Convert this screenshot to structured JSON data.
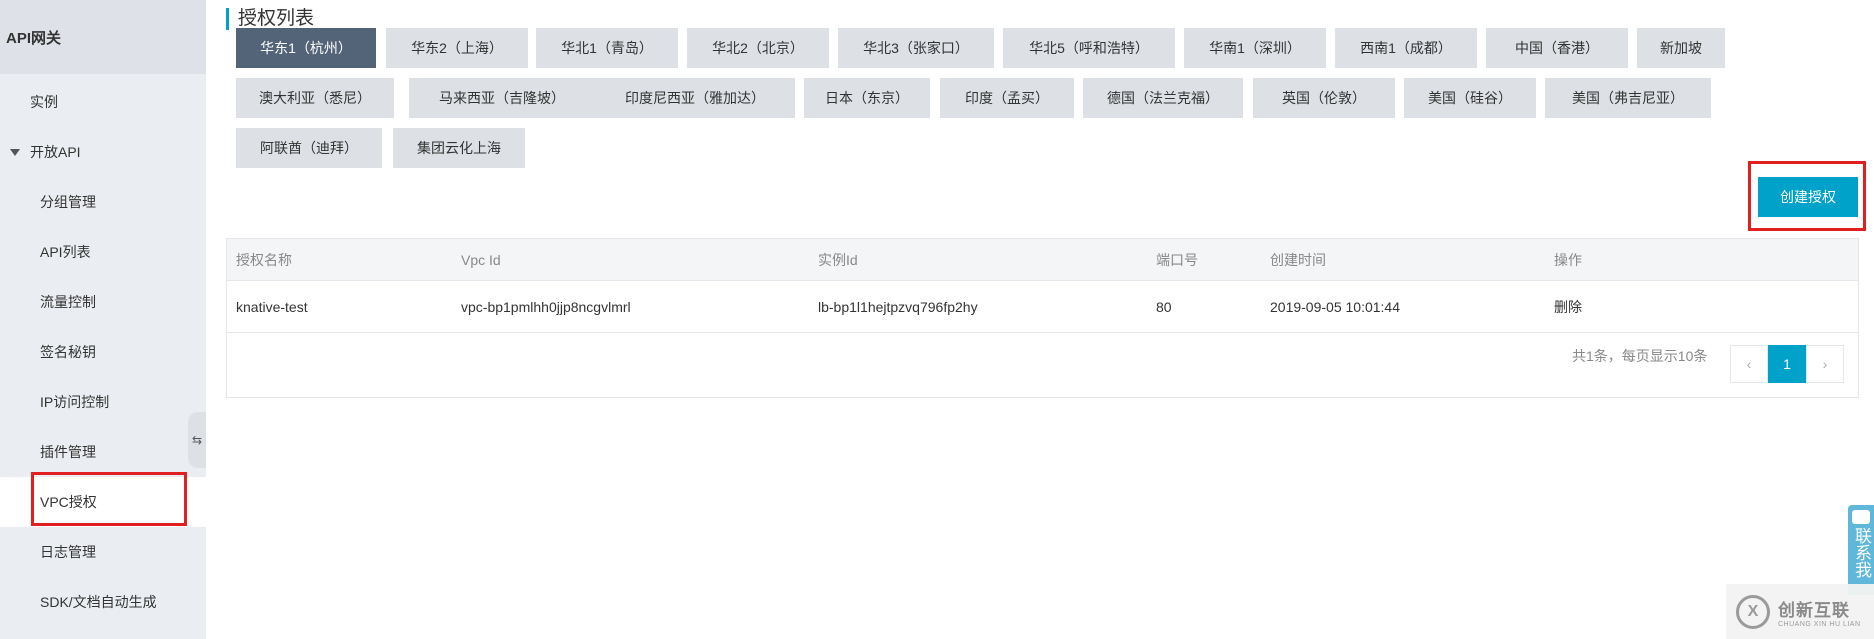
{
  "sidebar": {
    "title": "API网关",
    "items": [
      {
        "label": "实例"
      },
      {
        "label": "开放API"
      },
      {
        "label": "分组管理"
      },
      {
        "label": "API列表"
      },
      {
        "label": "流量控制"
      },
      {
        "label": "签名秘钥"
      },
      {
        "label": "IP访问控制"
      },
      {
        "label": "插件管理"
      },
      {
        "label": "VPC授权"
      },
      {
        "label": "日志管理"
      },
      {
        "label": "SDK/文档自动生成"
      }
    ],
    "collapse_glyph": "⇆"
  },
  "main": {
    "title": "授权列表",
    "regions": [
      "华东1（杭州）",
      "华东2（上海）",
      "华北1（青岛）",
      "华北2（北京）",
      "华北3（张家口）",
      "华北5（呼和浩特）",
      "华南1（深圳）",
      "西南1（成都）",
      "中国（香港）",
      "新加坡",
      "澳大利亚（悉尼）",
      "马来西亚（吉隆坡）",
      "印度尼西亚（雅加达）",
      "日本（东京）",
      "印度（孟买）",
      "德国（法兰克福）",
      "英国（伦敦）",
      "美国（硅谷）",
      "美国（弗吉尼亚）",
      "阿联酋（迪拜）",
      "集团云化上海"
    ],
    "active_region_index": 0,
    "create_button": "创建授权",
    "table": {
      "headers": [
        "授权名称",
        "Vpc Id",
        "实例Id",
        "端口号",
        "创建时间",
        "操作"
      ],
      "rows": [
        [
          "knative-test",
          "vpc-bp1pmlhh0jjp8ncgvlmrl",
          "lb-bp1l1hejtpzvq796fp2hy",
          "80",
          "2019-09-05 10:01:44",
          "删除"
        ]
      ]
    },
    "pagination": {
      "summary": "共1条，每页显示10条",
      "prev": "‹",
      "current": "1",
      "next": "›"
    }
  },
  "float": {
    "contact": "联系我",
    "watermark_cn": "创新互联",
    "watermark_en": "CHUANG XIN HU LIAN",
    "watermark_logo": "X"
  },
  "colors": {
    "accent": "#00a2ca",
    "active_tab": "#546478",
    "highlight": "#e02020"
  }
}
